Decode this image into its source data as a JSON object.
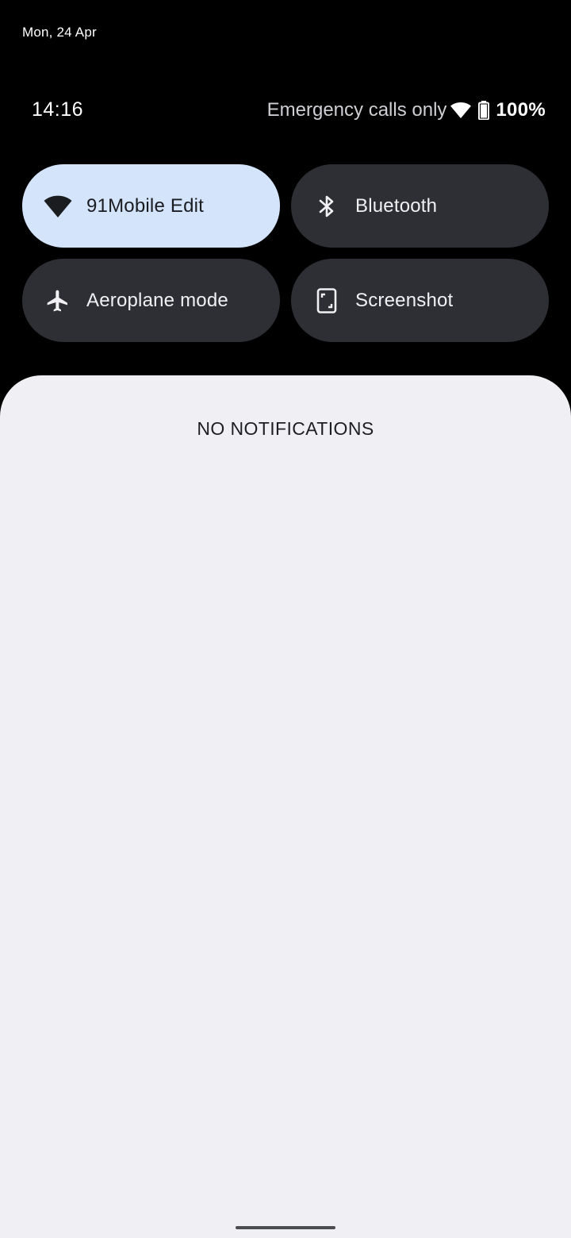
{
  "header": {
    "date": "Mon, 24 Apr",
    "time": "14:16"
  },
  "status_bar": {
    "carrier_text": "Emergency calls only",
    "wifi_icon": "wifi-icon",
    "battery_icon": "battery-icon",
    "battery_percent": "100%"
  },
  "quick_tiles": [
    {
      "label": "91Mobile Edit",
      "icon": "wifi-icon",
      "active": true
    },
    {
      "label": "Bluetooth",
      "icon": "bluetooth-icon",
      "active": false
    },
    {
      "label": "Aeroplane mode",
      "icon": "airplane-icon",
      "active": false
    },
    {
      "label": "Screenshot",
      "icon": "screenshot-icon",
      "active": false
    }
  ],
  "notifications": {
    "empty_text": "NO NOTIFICATIONS"
  },
  "colors": {
    "background": "#000000",
    "tile_inactive": "#2e2f34",
    "tile_active": "#d3e4fb",
    "panel": "#efeff4"
  }
}
